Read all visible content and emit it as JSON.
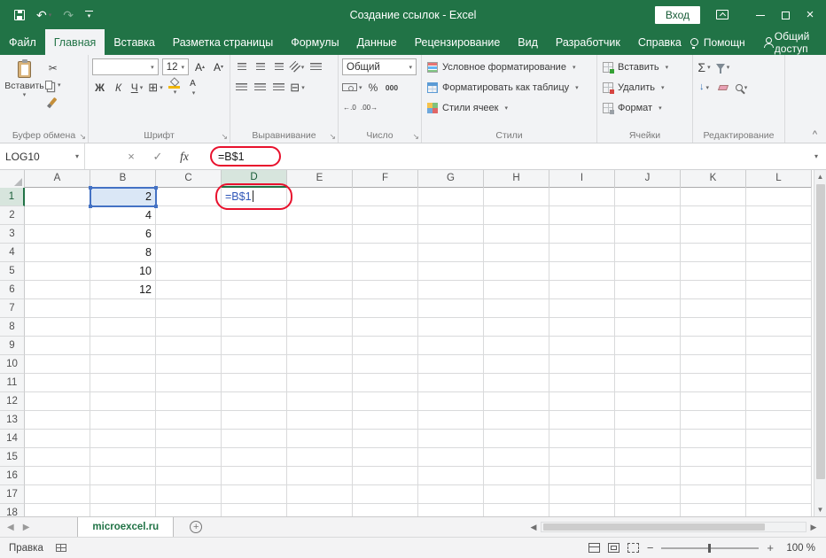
{
  "titlebar": {
    "title": "Создание ссылок  -  Excel",
    "signin_label": "Вход"
  },
  "ribbon_tabs": {
    "items": [
      {
        "label": "Файл",
        "type": "file"
      },
      {
        "label": "Главная",
        "type": "active"
      },
      {
        "label": "Вставка"
      },
      {
        "label": "Разметка страницы"
      },
      {
        "label": "Формулы"
      },
      {
        "label": "Данные"
      },
      {
        "label": "Рецензирование"
      },
      {
        "label": "Вид"
      },
      {
        "label": "Разработчик"
      },
      {
        "label": "Справка"
      }
    ],
    "assistant_label": "Помощн",
    "share_label": "Общий доступ"
  },
  "ribbon": {
    "group_labels": [
      "Буфер обмена",
      "Шрифт",
      "Выравнивание",
      "Число",
      "Стили",
      "Ячейки",
      "Редактирование"
    ],
    "paste_label": "Вставить",
    "bold_label": "Ж",
    "italic_label": "К",
    "underline_label": "Ч",
    "letter_a": "А",
    "font_size_value": "12",
    "number_format_value": "Общий",
    "percent_label": "%",
    "zeros_label": "000",
    "sigma_label": "Σ",
    "styles_buttons": [
      "Условное форматирование",
      "Форматировать как таблицу",
      "Стили ячеек"
    ],
    "cells_buttons": [
      "Вставить",
      "Удалить",
      "Формат"
    ]
  },
  "formula_bar": {
    "name_box_value": "LOG10",
    "fx_label": "fx",
    "formula_value": "=B$1"
  },
  "grid": {
    "columns": [
      "A",
      "B",
      "C",
      "D",
      "E",
      "F",
      "G",
      "H",
      "I",
      "J",
      "K",
      "L"
    ],
    "visible_rows": 17,
    "cells": [
      {
        "ref": "B1",
        "value": "2"
      },
      {
        "ref": "B2",
        "value": "4"
      },
      {
        "ref": "B3",
        "value": "6"
      },
      {
        "ref": "B4",
        "value": "8"
      },
      {
        "ref": "B5",
        "value": "10"
      },
      {
        "ref": "B6",
        "value": "12"
      }
    ],
    "editing_cell": {
      "ref": "D1",
      "text": "=B$1"
    },
    "referenced_cell": "B1",
    "selected_column": "D",
    "selected_row": 1
  },
  "sheet_bar": {
    "active_tab": "microexcel.ru"
  },
  "status_bar": {
    "mode_label": "Правка",
    "zoom_label": "100 %"
  },
  "colors": {
    "excel_green": "#217346",
    "annotation_red": "#e8112d",
    "reference_blue": "#4472c4"
  }
}
